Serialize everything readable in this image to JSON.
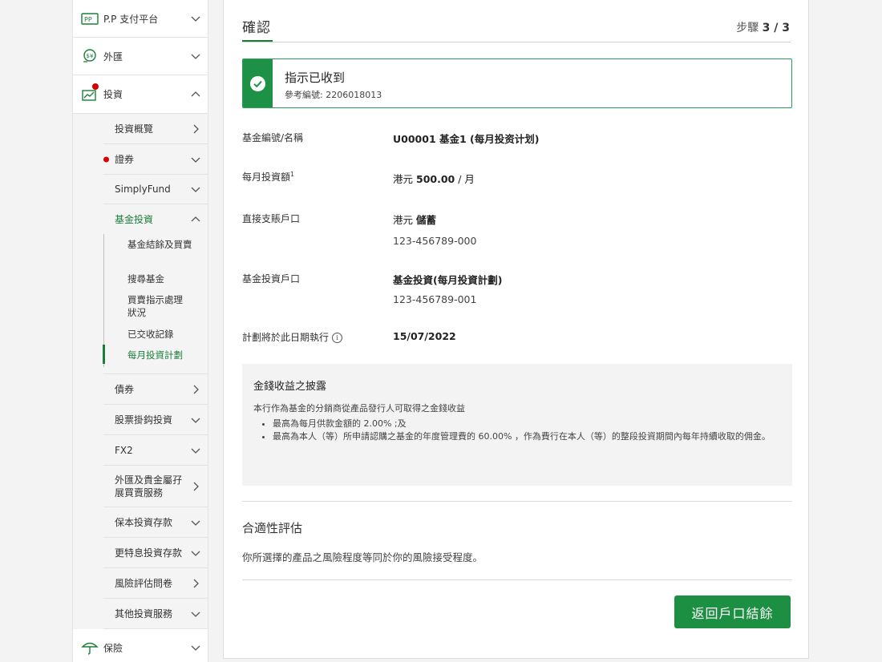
{
  "sidebar": {
    "top_items": [
      {
        "label": "P.P 支付平台",
        "icon": "payment-platform-icon"
      },
      {
        "label": "外匯",
        "icon": "fx-exchange-icon"
      },
      {
        "label": "投資",
        "icon": "investment-chart-icon"
      }
    ],
    "invest_sub": [
      {
        "label": "投資概覽",
        "chevron": "right"
      },
      {
        "label": "證券",
        "chevron": "down"
      },
      {
        "label": "SimplyFund",
        "chevron": "down"
      },
      {
        "label": "基金投資",
        "chevron": "up"
      }
    ],
    "fund_sub": [
      {
        "label": "基金結餘及買賣"
      },
      {
        "label": "搜尋基金"
      },
      {
        "label": "買賣指示處理狀況"
      },
      {
        "label": "已交收記錄"
      },
      {
        "label": "每月投資計劃"
      }
    ],
    "more_sub": [
      {
        "label": "債券",
        "chevron": "right"
      },
      {
        "label": "股票掛鈎投資",
        "chevron": "down"
      },
      {
        "label": "FX2",
        "chevron": "down"
      },
      {
        "label": "外匯及貴金屬孖展買賣服務",
        "chevron": "right"
      },
      {
        "label": "保本投資存款",
        "chevron": "down"
      },
      {
        "label": "更特息投資存款",
        "chevron": "down"
      },
      {
        "label": "風險評估問卷",
        "chevron": "right"
      },
      {
        "label": "其他投資服務",
        "chevron": "down"
      }
    ],
    "insurance": {
      "label": "保險",
      "icon": "umbrella-icon"
    }
  },
  "main": {
    "tab_title": "確認",
    "step_prefix": "步驟",
    "step_value": "3 / 3",
    "success": {
      "title": "指示已收到",
      "ref": "參考編號: 2206018013"
    },
    "rows": {
      "fund_label": "基金編號/名稱",
      "fund_value": "U00001 基金1 (每月投资计划)",
      "monthly_label": "每月投資額",
      "monthly_sup": "1",
      "monthly_currency": "港元",
      "monthly_amount": "500.00",
      "monthly_suffix": "/ 月",
      "debit_label": "直接支賬戶口",
      "debit_currency": "港元",
      "debit_type": "儲蓄",
      "debit_account": "123-456789-000",
      "invest_label": "基金投資戶口",
      "invest_value": "基金投資(每月投資計劃)",
      "invest_account": "123-456789-001",
      "date_label": "計劃將於此日期執行",
      "date_value": "15/07/2022"
    },
    "disclosure": {
      "title": "金錢收益之披露",
      "intro": "本行作為基金的分銷商從產品發行人可取得之金錢收益",
      "bullets": [
        "最高為每月供款金額的 2.00% ;及",
        "最高為本人（等）所申請認購之基金的年度管理費的 60.00% ，作為費行在本人（等）的整段投資期間內每年持續收取的佣金。"
      ]
    },
    "suitability": {
      "title": "合適性評估",
      "text": "你所選擇的產品之風險程度等同於你的風險接受程度。"
    },
    "back_button": "返回戶口結餘"
  },
  "colors": {
    "brand_green": "#1c8f43",
    "alert_red": "#d40000"
  }
}
